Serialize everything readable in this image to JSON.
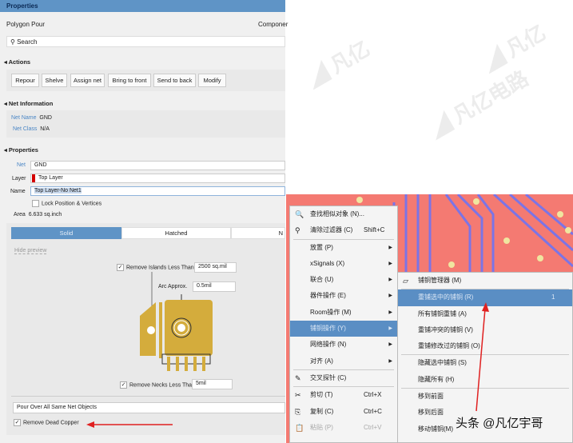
{
  "panel": {
    "title": "Properties",
    "object": "Polygon Pour",
    "component_tab": "Componer",
    "search_placeholder": "Search",
    "actions_header": "Actions",
    "actions": [
      "Repour",
      "Shelve",
      "Assign net",
      "Bring to front",
      "Send to back",
      "Modify"
    ],
    "net_info_header": "Net Information",
    "net_name_label": "Net Name",
    "net_name": "GND",
    "net_class_label": "Net Class",
    "net_class": "N/A",
    "properties_header": "Properties",
    "net_label": "Net",
    "net": "GND",
    "layer_label": "Layer",
    "layer": "Top Layer",
    "layer_color": "#d40000",
    "name_label": "Name",
    "name": "Top Layer-No Net1",
    "lock_label": "Lock Position & Vertices",
    "area_label": "Area",
    "area": "6.633 sq.inch",
    "fill_tabs": [
      "Solid",
      "Hatched",
      "N"
    ],
    "hide_preview": "Hide preview",
    "remove_islands_label": "Remove Islands Less Than",
    "remove_islands_value": "2500 sq.mil",
    "arc_label": "Arc Approx.",
    "arc_value": "0.5mil",
    "remove_necks_label": "Remove Necks Less Than",
    "remove_necks_value": "5mil",
    "pour_over": "Pour Over All Same Net Objects",
    "remove_dead_copper": "Remove Dead Copper"
  },
  "context_menu": [
    {
      "label": "查找相似对象 (N)...",
      "icon": "search-icon"
    },
    {
      "label": "清除过滤器 (C)",
      "shortcut": "Shift+C",
      "icon": "filter-clear-icon"
    },
    {
      "label": "放置 (P)",
      "submenu": true
    },
    {
      "label": "xSignals (X)",
      "submenu": true
    },
    {
      "label": "联合 (U)",
      "submenu": true
    },
    {
      "label": "器件操作 (E)",
      "submenu": true
    },
    {
      "label": "Room操作 (M)",
      "submenu": true
    },
    {
      "label": "铺铜操作 (Y)",
      "submenu": true,
      "selected": true
    },
    {
      "label": "网络操作 (N)",
      "submenu": true
    },
    {
      "label": "对齐 (A)",
      "submenu": true
    },
    {
      "label": "交叉探针 (C)",
      "icon": "probe-icon"
    },
    {
      "label": "剪切 (T)",
      "shortcut": "Ctrl+X",
      "icon": "scissors-icon"
    },
    {
      "label": "复制 (C)",
      "shortcut": "Ctrl+C",
      "icon": "copy-icon"
    },
    {
      "label": "粘贴 (P)",
      "shortcut": "Ctrl+V",
      "icon": "paste-icon"
    }
  ],
  "submenu": [
    {
      "label": "铺铜管理器 (M)"
    },
    {
      "label": "重铺选中的铺铜 (R)",
      "shortcut": "1",
      "selected": true
    },
    {
      "label": "所有铺铜重铺 (A)"
    },
    {
      "label": "重铺冲突的铺铜 (V)"
    },
    {
      "label": "重铺修改过的铺铜 (O)"
    },
    {
      "label": "隐藏选中铺铜 (S)"
    },
    {
      "label": "隐藏所有 (H)"
    },
    {
      "label": "移到前面"
    },
    {
      "label": "移到后面"
    },
    {
      "label": "移动铺铜(M)"
    }
  ],
  "watermark": "头条 @凡亿宇哥",
  "colors": {
    "accent": "#5a8ec4",
    "arrow": "#e02020",
    "pcb": "#f47a72",
    "copper": "#d4ac3c"
  }
}
